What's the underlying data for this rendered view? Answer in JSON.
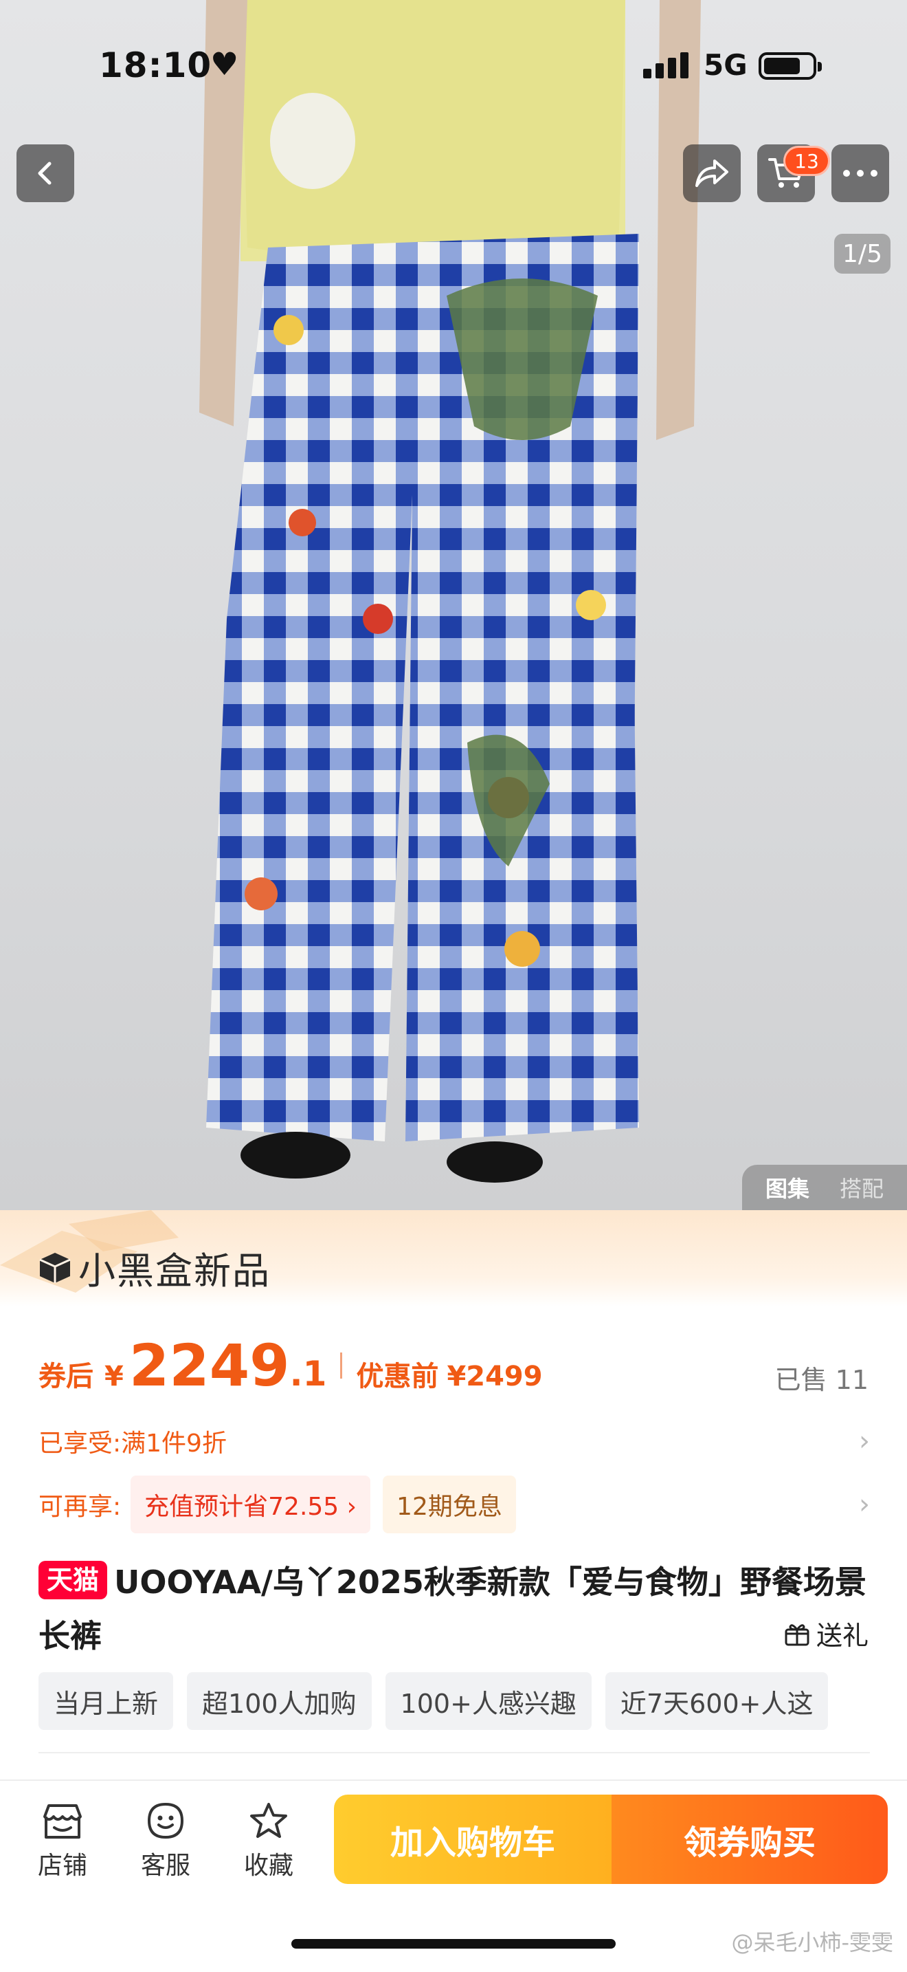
{
  "status_bar": {
    "time": "18:10",
    "network": "5G"
  },
  "gallery": {
    "page": "1/5",
    "tabs": [
      "图集",
      "搭配"
    ],
    "cart_count": "13"
  },
  "banner": {
    "logo_text": "小黑盒新品"
  },
  "price": {
    "label": "券后",
    "currency": "¥",
    "integer": "2249",
    "decimal": ".1",
    "original_label": "优惠前",
    "original": "¥2499",
    "sold": "已售 11"
  },
  "promotions": {
    "enjoyed_label": "已享受:",
    "enjoyed_text": "满1件9折",
    "more_label": "可再享:",
    "recharge_chip": "充值预计省72.55 ›",
    "installment_chip": "12期免息"
  },
  "product": {
    "badge": "天猫",
    "title": "UOOYAA/乌丫2025秋季新款「爱与食物」野餐场景长裤",
    "gift_label": "送礼"
  },
  "tags": [
    "当月上新",
    "超100人加购",
    "100+人感兴趣",
    "近7天600+人这"
  ],
  "bottom_bar": {
    "store": "店铺",
    "service": "客服",
    "favorite": "收藏",
    "add_to_cart": "加入购物车",
    "buy_now": "领券购买"
  },
  "watermark": "@呆毛小柿-雯雯",
  "colors": {
    "accent_orange": "#f05a14",
    "tmall_red": "#ff0036",
    "cart_yellow": "#ffbf25",
    "buy_orange": "#ff6a1c"
  }
}
